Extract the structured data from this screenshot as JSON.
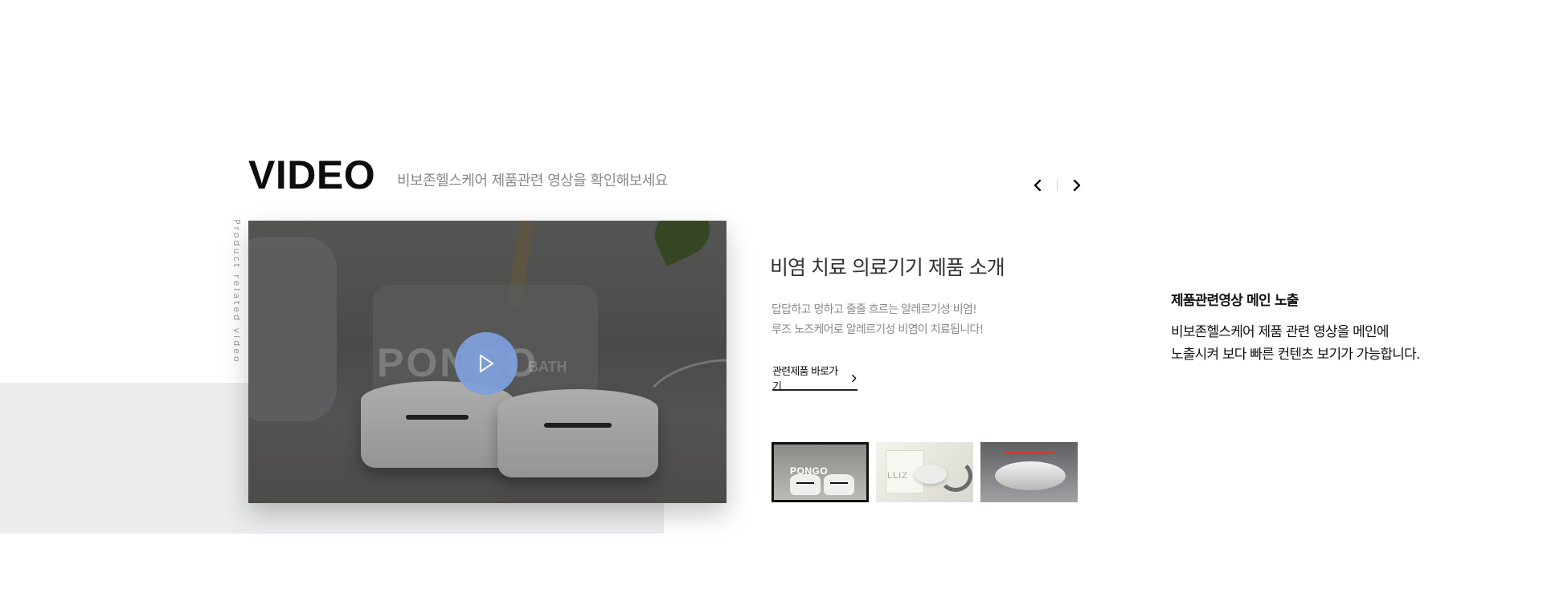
{
  "section": {
    "title": "VIDEO",
    "subtitle": "비보존헬스케어 제품관련 영상을 확인해보세요",
    "vertical_label": "Product related video"
  },
  "slider_nav": {
    "prev_icon": "chevron-left-icon",
    "next_icon": "chevron-right-icon"
  },
  "video": {
    "brand_text": "PONGO",
    "brand_sub": "BATH",
    "play_icon": "play-icon",
    "play_button_color": "#7f9fdc"
  },
  "detail": {
    "title": "비염 치료 의료기기 제품 소개",
    "description": [
      "답답하고 멍하고 줄줄 흐르는 알레르기성 비염!",
      "루즈 노즈케어로 알레르기성 비염이 치료됩니다!"
    ],
    "link_label": "관련제품 바로가기",
    "link_icon": "chevron-right-icon"
  },
  "thumbnails": [
    {
      "brand": "PONGO",
      "active": true
    },
    {
      "brand": "LLIZ",
      "active": false
    },
    {
      "brand": "",
      "active": false
    }
  ],
  "annotation": {
    "title": "제품관련영상 메인 노출",
    "lines": [
      "비보존헬스케어 제품 관련 영상을 메인에",
      "노출시켜 보다 빠른 컨텐츠 보기가 가능합니다."
    ]
  }
}
